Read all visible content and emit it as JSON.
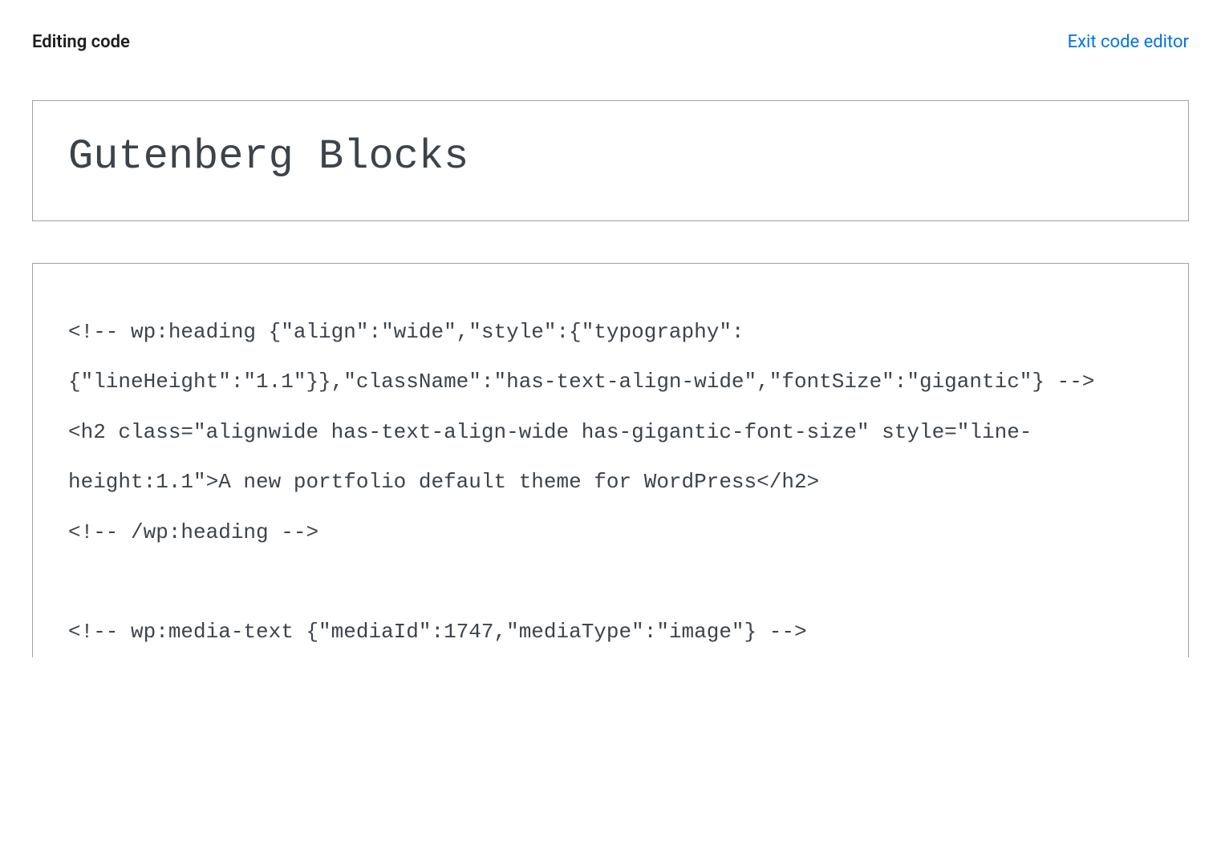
{
  "header": {
    "label": "Editing code",
    "exit_link": "Exit code editor"
  },
  "editor": {
    "title": "Gutenberg Blocks",
    "code_content": "<!-- wp:heading {\"align\":\"wide\",\"style\":{\"typography\":{\"lineHeight\":\"1.1\"}},\"className\":\"has-text-align-wide\",\"fontSize\":\"gigantic\"} -->\n<h2 class=\"alignwide has-text-align-wide has-gigantic-font-size\" style=\"line-height:1.1\">A new portfolio default theme for WordPress</h2>\n<!-- /wp:heading -->\n\n<!-- wp:media-text {\"mediaId\":1747,\"mediaType\":\"image\"} -->"
  }
}
